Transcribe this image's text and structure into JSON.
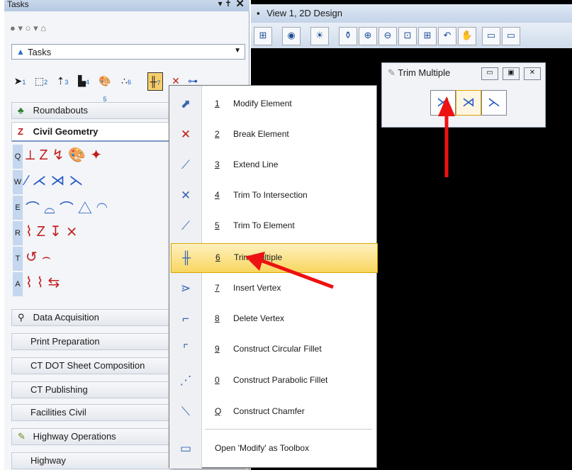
{
  "tasks_panel": {
    "title": "Tasks",
    "pin_glyph": "▾ ✝",
    "close_glyph": "✕",
    "nav_glyphs": "● ▾ ○ ▾ ⌂",
    "combo_value": "Tasks",
    "toolbar_numbers": [
      "1",
      "2",
      "3",
      "4",
      "5",
      "6",
      "7"
    ],
    "groups_top": [
      {
        "label": "Roundabouts",
        "icon": "roundabout-icon",
        "glyph": "♣"
      },
      {
        "label": "Civil Geometry",
        "icon": "civil-geometry-icon",
        "glyph": "Z"
      }
    ],
    "tool_rows": [
      {
        "key": "Q",
        "glyphs": "⟂Z↯🎨✦",
        "color": "red"
      },
      {
        "key": "W",
        "glyphs": "∕⋌⋊⋋",
        "color": "blue"
      },
      {
        "key": "E",
        "glyphs": "⌒⌓⌒△◠",
        "color": "blue"
      },
      {
        "key": "R",
        "glyphs": "⌇Z↧⨯",
        "color": "red"
      },
      {
        "key": "T",
        "glyphs": "↺⌢",
        "color": "red"
      },
      {
        "key": "A",
        "glyphs": "⌇⌇⇆",
        "color": "red"
      }
    ],
    "groups_bottom": [
      {
        "label": "Data Acquisition",
        "glyph": "⚲"
      },
      {
        "label": "Print Preparation",
        "glyph": ""
      },
      {
        "label": "CT DOT Sheet Composition",
        "glyph": ""
      },
      {
        "label": "CT Publishing",
        "glyph": ""
      },
      {
        "label": "Facilities Civil",
        "glyph": ""
      },
      {
        "label": "Highway Operations",
        "glyph": "✎"
      },
      {
        "label": "Highway",
        "glyph": ""
      }
    ]
  },
  "view_window": {
    "title": "View 1, 2D Design",
    "title_icon": "▪",
    "toolbar_glyphs": [
      "⊞",
      "◉",
      "☀",
      "⚱",
      "⊕",
      "⊖",
      "⊡",
      "⊞",
      "↶",
      "✋",
      "▭",
      "▭"
    ]
  },
  "trim_toolbox": {
    "title": "Trim Multiple",
    "icon_glyph": "✎",
    "buttons": [
      "▭",
      "▣",
      "✕"
    ],
    "tools": [
      "⋊",
      "⋊",
      "⋋"
    ]
  },
  "context_menu": {
    "items": [
      {
        "num": "1",
        "label": "Modify Element",
        "icon": "modify-element-icon",
        "glyph": "⬈"
      },
      {
        "num": "2",
        "label": "Break Element",
        "icon": "break-element-icon",
        "glyph": "✕"
      },
      {
        "num": "3",
        "label": "Extend Line",
        "icon": "extend-line-icon",
        "glyph": "⟋"
      },
      {
        "num": "4",
        "label": "Trim To Intersection",
        "icon": "trim-to-intersection-icon",
        "glyph": "✕"
      },
      {
        "num": "5",
        "label": "Trim To Element",
        "icon": "trim-to-element-icon",
        "glyph": "⟋"
      },
      {
        "num": "6",
        "label": "Trim Multiple",
        "icon": "trim-multiple-icon",
        "glyph": "╫"
      },
      {
        "num": "7",
        "label": "Insert Vertex",
        "icon": "insert-vertex-icon",
        "glyph": "⋗"
      },
      {
        "num": "8",
        "label": "Delete Vertex",
        "icon": "delete-vertex-icon",
        "glyph": "⌐"
      },
      {
        "num": "9",
        "label": "Construct Circular Fillet",
        "icon": "circular-fillet-icon",
        "glyph": "⌜"
      },
      {
        "num": "0",
        "label": "Construct Parabolic Fillet",
        "icon": "parabolic-fillet-icon",
        "glyph": "⋰"
      },
      {
        "num": "Q",
        "label": "Construct Chamfer",
        "icon": "chamfer-icon",
        "glyph": "⟍"
      }
    ],
    "open_toolbox_label": "Open 'Modify' as Toolbox",
    "open_toolbox_glyph": "▭"
  }
}
